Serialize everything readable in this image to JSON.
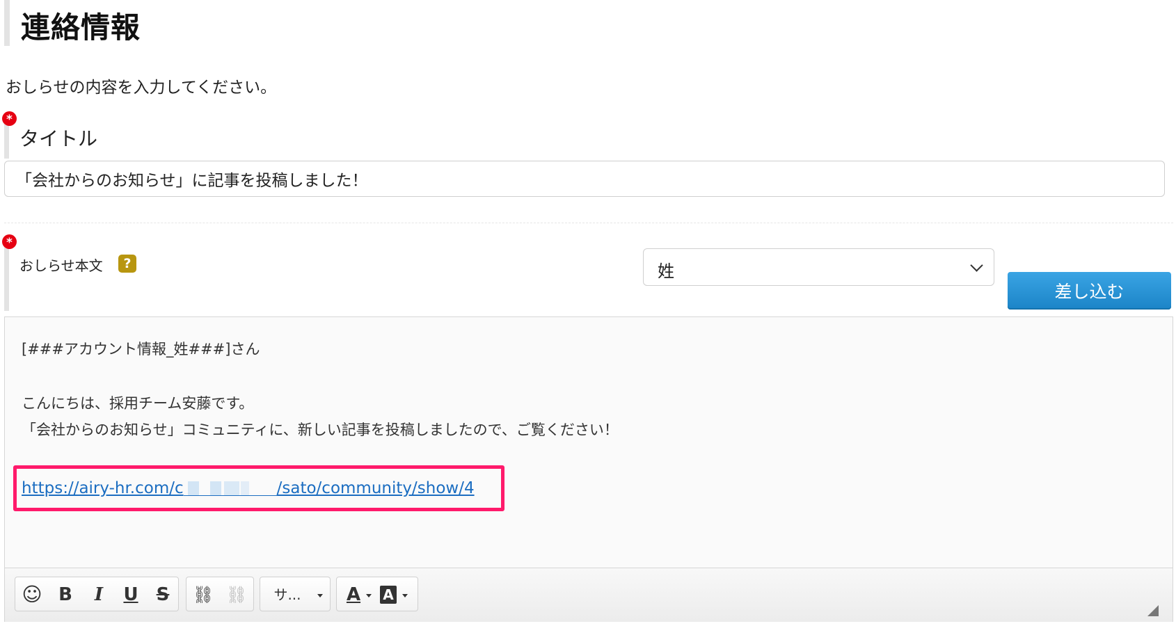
{
  "header": {
    "title": "連絡情報"
  },
  "instruction": "おしらせの内容を入力してください。",
  "required_mark": "*",
  "title_field": {
    "label": "タイトル",
    "value": "「会社からのお知らせ」に記事を投稿しました！"
  },
  "body_field": {
    "label": "おしらせ本文",
    "help_icon": "?",
    "insert_select": {
      "selected": "姓"
    },
    "insert_button": "差し込む"
  },
  "editor": {
    "lines": [
      "[###アカウント情報_姓###]さん",
      "こんにちは、採用チーム安藤です。",
      "「会社からのお知らせ」コミュニティに、新しい記事を投稿しましたので、ご覧ください！"
    ],
    "link_prefix": "https://airy-hr.com/c",
    "link_suffix": "/sato/community/show/4",
    "highlight_color": "#ff1a6b"
  },
  "toolbar": {
    "buttons": {
      "emoji": "☺",
      "bold": "B",
      "italic": "I",
      "underline": "U",
      "strike": "S",
      "link": "⛓",
      "unlink": "⛓",
      "format": "サ...",
      "text_color": "A",
      "bg_color": "A"
    },
    "icons": [
      "smiley-icon",
      "bold-icon",
      "italic-icon",
      "underline-icon",
      "strikethrough-icon",
      "link-icon",
      "unlink-icon",
      "text-color-icon",
      "background-color-icon",
      "resize-grip-icon"
    ]
  }
}
